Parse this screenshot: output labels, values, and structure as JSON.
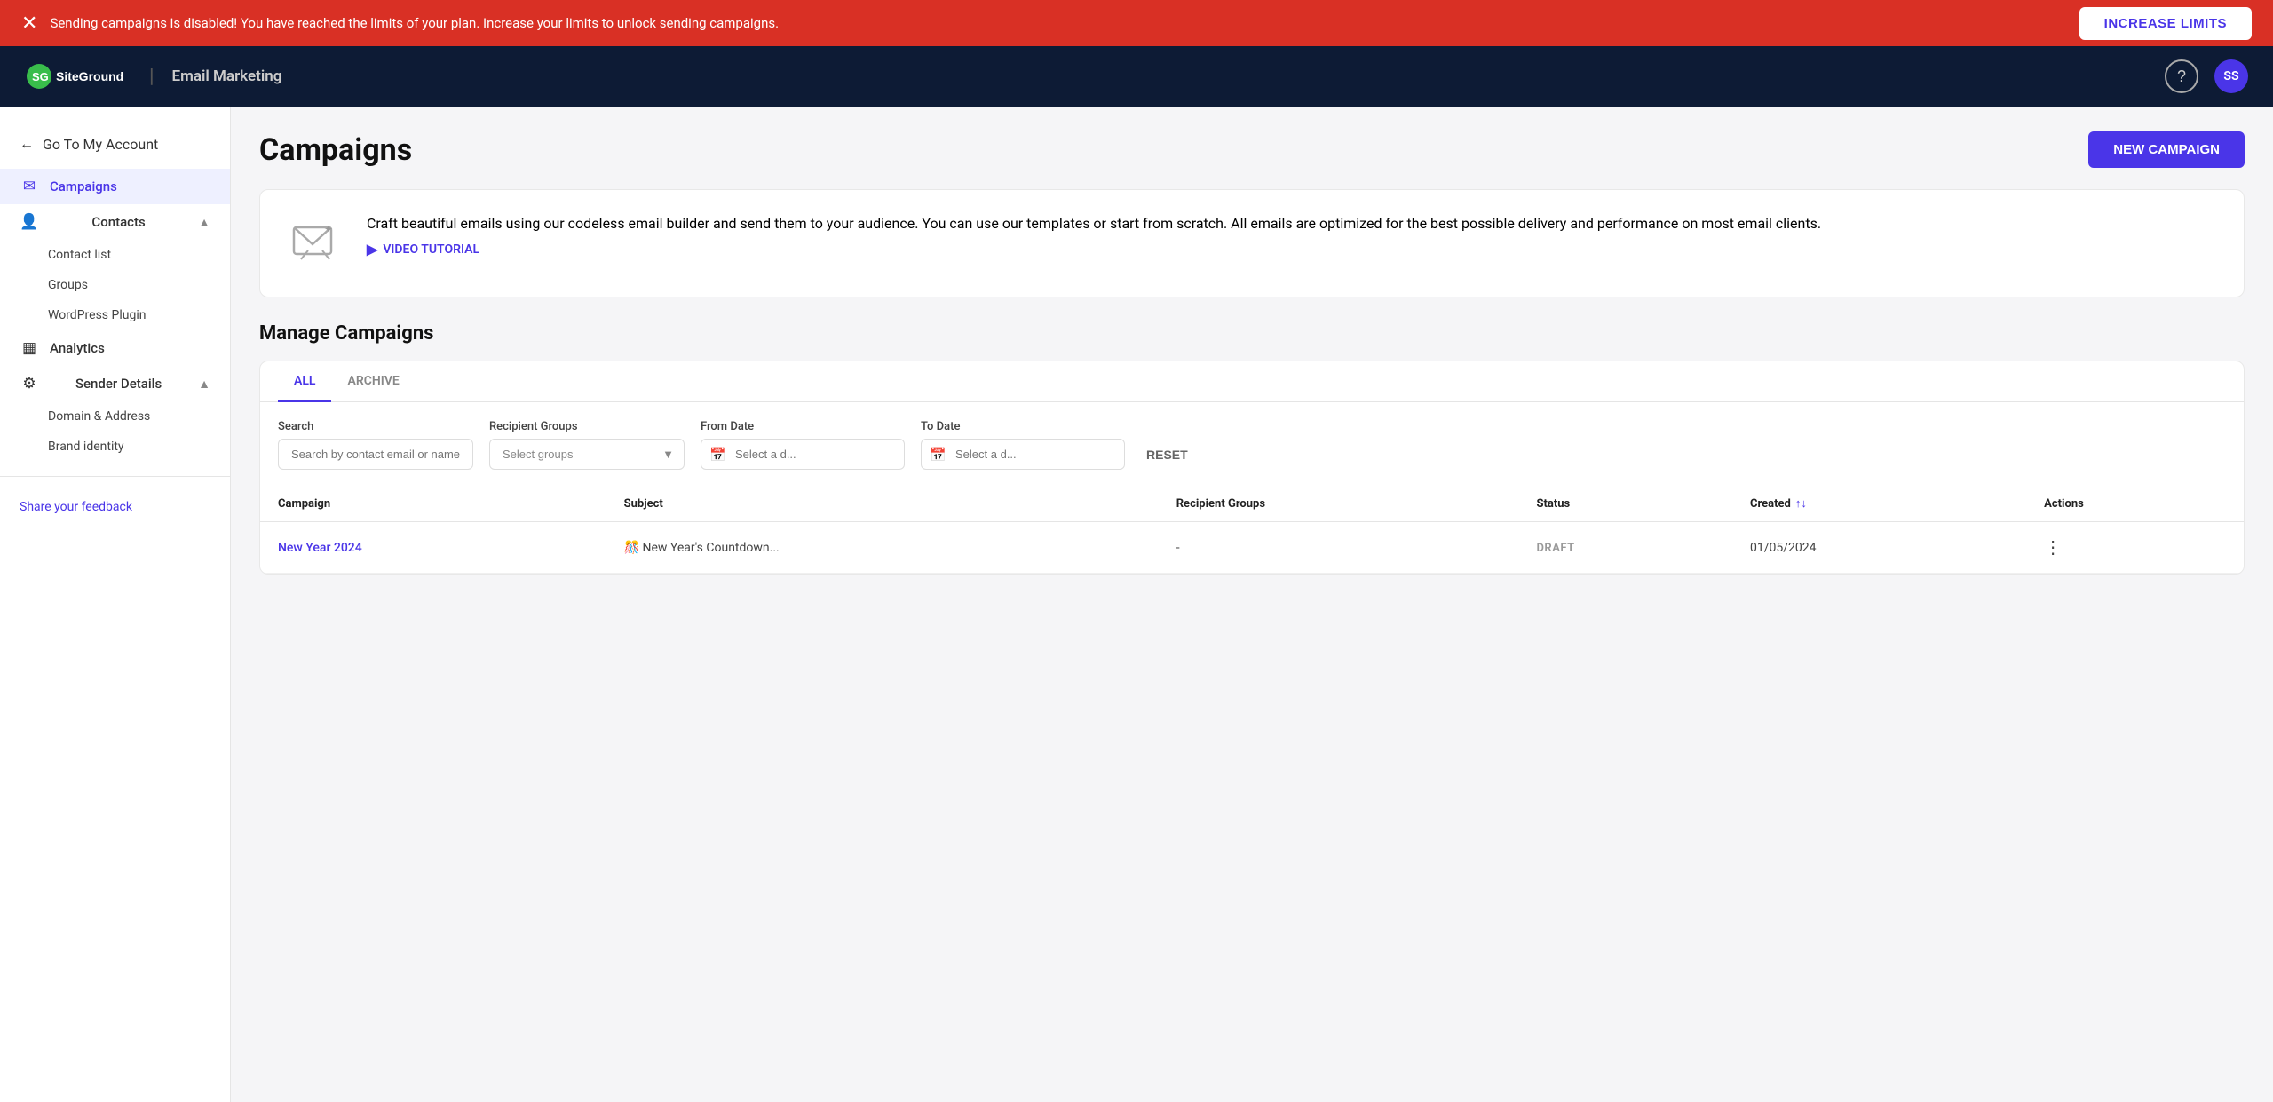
{
  "alert": {
    "message": "Sending campaigns is disabled! You have reached the limits of your plan. Increase your limits to unlock sending campaigns.",
    "button_label": "INCREASE LIMITS",
    "close_icon": "✕"
  },
  "nav": {
    "logo_text": "SiteGround",
    "divider": "|",
    "app_title": "Email Marketing",
    "help_icon": "?",
    "user_initials": "SS"
  },
  "sidebar": {
    "back_label": "Go To My Account",
    "back_icon": "←",
    "items": [
      {
        "id": "campaigns",
        "label": "Campaigns",
        "icon": "✉",
        "active": true
      },
      {
        "id": "contacts",
        "label": "Contacts",
        "icon": "👤",
        "expanded": true
      },
      {
        "id": "contact-list",
        "label": "Contact list",
        "sub": true
      },
      {
        "id": "groups",
        "label": "Groups",
        "sub": true
      },
      {
        "id": "wordpress-plugin",
        "label": "WordPress Plugin",
        "sub": true
      },
      {
        "id": "analytics",
        "label": "Analytics",
        "icon": "📊",
        "active": false
      },
      {
        "id": "sender-details",
        "label": "Sender Details",
        "icon": "⚙",
        "expanded": true
      },
      {
        "id": "domain-address",
        "label": "Domain & Address",
        "sub": true
      },
      {
        "id": "brand-identity",
        "label": "Brand identity",
        "sub": true
      }
    ],
    "feedback_label": "Share your feedback"
  },
  "page": {
    "title": "Campaigns",
    "new_campaign_label": "NEW CAMPAIGN"
  },
  "info_card": {
    "text": "Craft beautiful emails using our codeless email builder and send them to your audience. You can use our templates or start from scratch. All emails are optimized for the best possible delivery and performance on most email clients.",
    "video_link": "VIDEO TUTORIAL"
  },
  "manage": {
    "title": "Manage Campaigns",
    "tabs": [
      {
        "id": "all",
        "label": "ALL",
        "active": true
      },
      {
        "id": "archive",
        "label": "ARCHIVE",
        "active": false
      }
    ],
    "filters": {
      "search_label": "Search",
      "search_placeholder": "Search by contact email or name",
      "groups_label": "Recipient Groups",
      "groups_placeholder": "Select groups",
      "from_date_label": "From Date",
      "from_date_placeholder": "Select a d...",
      "to_date_label": "To Date",
      "to_date_placeholder": "Select a d...",
      "reset_label": "RESET"
    },
    "table": {
      "columns": [
        {
          "id": "campaign",
          "label": "Campaign"
        },
        {
          "id": "subject",
          "label": "Subject"
        },
        {
          "id": "recipient_groups",
          "label": "Recipient Groups"
        },
        {
          "id": "status",
          "label": "Status"
        },
        {
          "id": "created",
          "label": "Created"
        },
        {
          "id": "actions",
          "label": "Actions"
        }
      ],
      "rows": [
        {
          "campaign": "New Year 2024",
          "subject": "🎊 New Year's Countdown...",
          "recipient_groups": "-",
          "status": "DRAFT",
          "created": "01/05/2024"
        }
      ]
    }
  }
}
